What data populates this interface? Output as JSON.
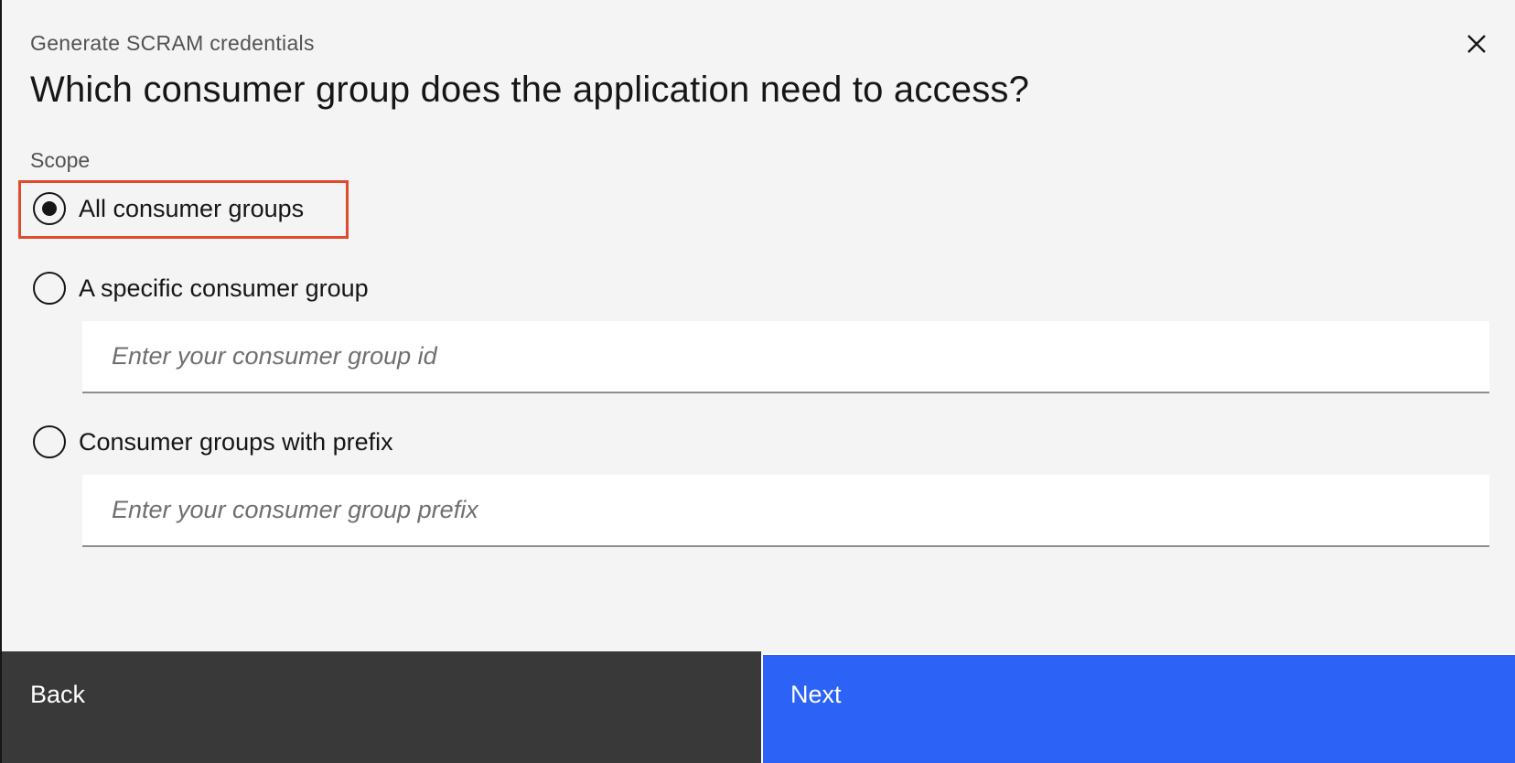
{
  "modal": {
    "eyebrow": "Generate SCRAM credentials",
    "heading": "Which consumer group does the application need to access?",
    "close_icon": "close-icon"
  },
  "scope": {
    "label": "Scope",
    "options": [
      {
        "label": "All consumer groups",
        "selected": true
      },
      {
        "label": "A specific consumer group",
        "selected": false
      },
      {
        "label": "Consumer groups with prefix",
        "selected": false
      }
    ],
    "group_id_placeholder": "Enter your consumer group id",
    "group_prefix_placeholder": "Enter your consumer group prefix"
  },
  "footer": {
    "back_label": "Back",
    "next_label": "Next"
  },
  "colors": {
    "background": "#f4f4f4",
    "primary": "#2c62f5",
    "secondary": "#393939",
    "highlight": "#e04a2f"
  }
}
